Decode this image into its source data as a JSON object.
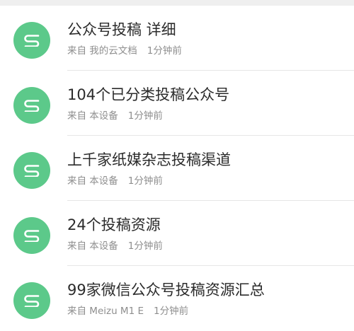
{
  "items": [
    {
      "title": "公众号投稿 详细",
      "source": "来自 我的云文档",
      "time": "1分钟前"
    },
    {
      "title": "104个已分类投稿公众号",
      "source": "来自 本设备",
      "time": "1分钟前"
    },
    {
      "title": "上千家纸媒杂志投稿渠道",
      "source": "来自 本设备",
      "time": "1分钟前"
    },
    {
      "title": "24个投稿资源",
      "source": "来自 本设备",
      "time": "1分钟前"
    },
    {
      "title": "99家微信公众号投稿资源汇总",
      "source": "来自 Meizu M1 E",
      "time": "1分钟前"
    }
  ],
  "colors": {
    "avatar": "#5cc98a"
  },
  "icons": {
    "avatar": "s-logo-icon"
  }
}
